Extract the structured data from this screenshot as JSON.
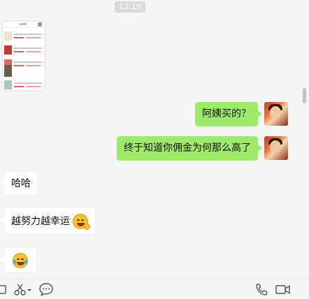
{
  "chat": {
    "timestamp": "13:19",
    "messages": [
      {
        "side": "left",
        "kind": "image",
        "content": "product-list-screenshot"
      },
      {
        "side": "right",
        "kind": "text",
        "text": "阿姨买的？"
      },
      {
        "side": "right",
        "kind": "text",
        "text": "终于知道你佣金为何那么高了"
      },
      {
        "side": "left",
        "kind": "text",
        "text": "哈哈"
      },
      {
        "side": "left",
        "kind": "text",
        "text": "越努力越幸运",
        "emoji": "yummy-face-emoji"
      },
      {
        "side": "left",
        "kind": "emoji",
        "emoji": "laughing-tears-emoji"
      }
    ]
  },
  "toolbar": {
    "icons": [
      "folder-icon",
      "scissors-icon",
      "dropdown-arrow-icon",
      "chat-bubble-icon",
      "phone-icon",
      "video-camera-icon"
    ]
  },
  "colors": {
    "my_bubble": "#9eea6a",
    "their_bubble": "#ffffff",
    "background": "#f5f5f5"
  }
}
